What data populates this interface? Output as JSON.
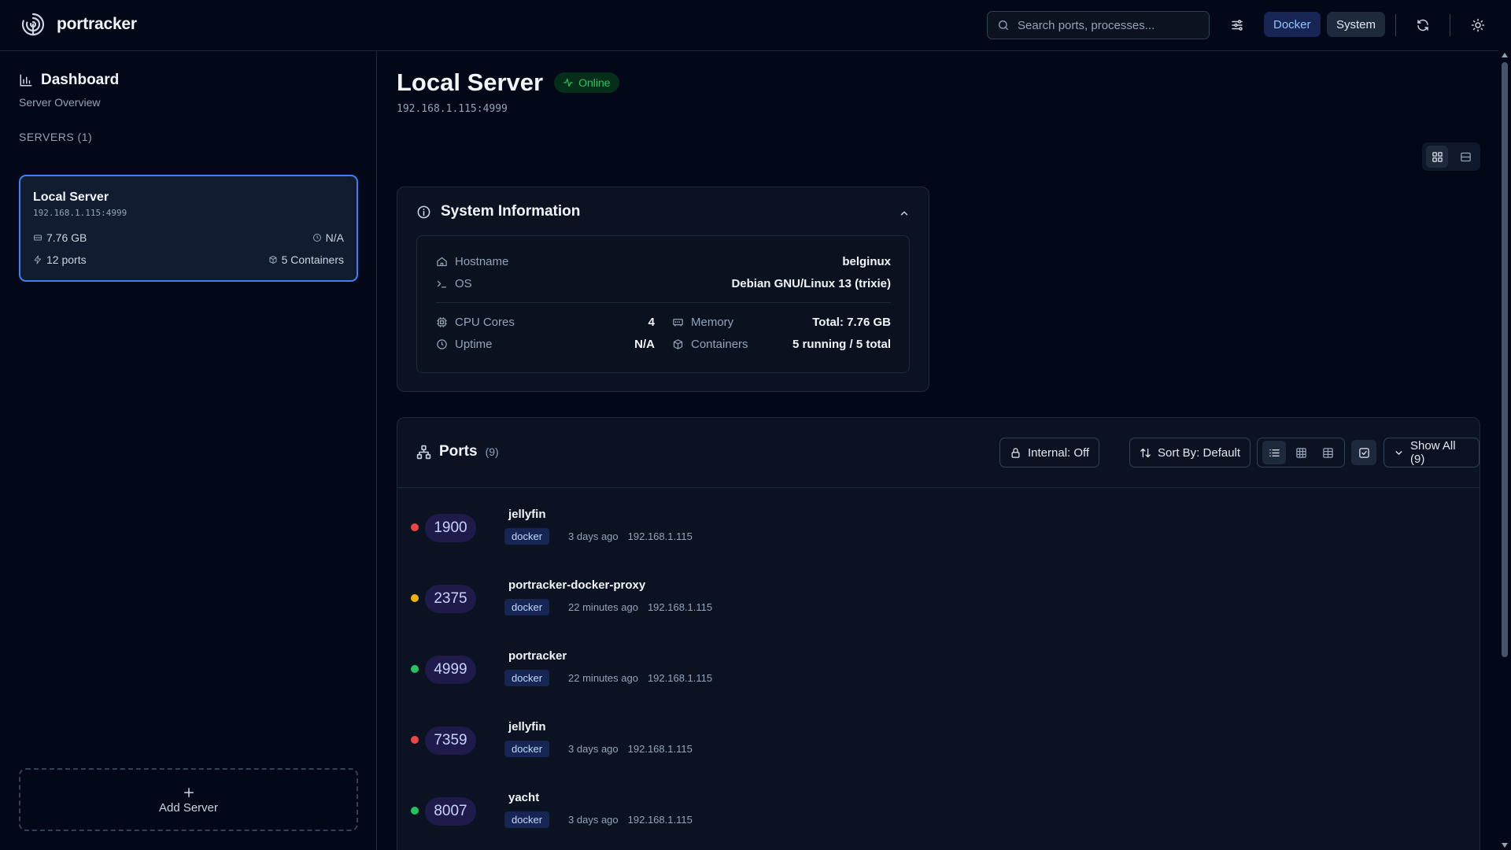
{
  "header": {
    "app_name": "portracker",
    "search_placeholder": "Search ports, processes...",
    "docker_label": "Docker",
    "system_label": "System",
    "icons": [
      "logo-icon",
      "search-icon",
      "filter-sliders-icon",
      "refresh-icon",
      "theme-sun-icon"
    ]
  },
  "sidebar": {
    "title": "Dashboard",
    "subtitle": "Server Overview",
    "section_label": "SERVERS (1)",
    "server": {
      "name": "Local Server",
      "address": "192.168.1.115:4999",
      "memory": "7.76 GB",
      "uptime": "N/A",
      "ports": "12 ports",
      "containers": "5 Containers"
    },
    "add_server_label": "Add Server"
  },
  "main": {
    "title": "Local Server",
    "status": "Online",
    "address": "192.168.1.115:4999",
    "system_info": {
      "title": "System Information",
      "hostname_label": "Hostname",
      "hostname": "belginux",
      "os_label": "OS",
      "os": "Debian GNU/Linux 13 (trixie)",
      "cpu_label": "CPU Cores",
      "cpu": "4",
      "memory_label": "Memory",
      "memory": "Total: 7.76 GB",
      "uptime_label": "Uptime",
      "uptime": "N/A",
      "containers_label": "Containers",
      "containers": "5 running / 5 total"
    },
    "ports": {
      "title": "Ports",
      "count": "(9)",
      "internal_label": "Internal: Off",
      "sort_label": "Sort By: Default",
      "show_all_label": "Show All (9)",
      "rows": [
        {
          "status": "red",
          "port": "1900",
          "name": "jellyfin",
          "source": "docker",
          "time": "3 days ago",
          "ip": "192.168.1.115"
        },
        {
          "status": "amber",
          "port": "2375",
          "name": "portracker-docker-proxy",
          "source": "docker",
          "time": "22 minutes ago",
          "ip": "192.168.1.115"
        },
        {
          "status": "green",
          "port": "4999",
          "name": "portracker",
          "source": "docker",
          "time": "22 minutes ago",
          "ip": "192.168.1.115"
        },
        {
          "status": "red",
          "port": "7359",
          "name": "jellyfin",
          "source": "docker",
          "time": "3 days ago",
          "ip": "192.168.1.115"
        },
        {
          "status": "green",
          "port": "8007",
          "name": "yacht",
          "source": "docker",
          "time": "3 days ago",
          "ip": "192.168.1.115"
        }
      ]
    }
  },
  "colors": {
    "background": "#020817",
    "accent": "#3b82f6",
    "status_red": "#ef4444",
    "status_amber": "#eab308",
    "status_green": "#22c55e"
  }
}
